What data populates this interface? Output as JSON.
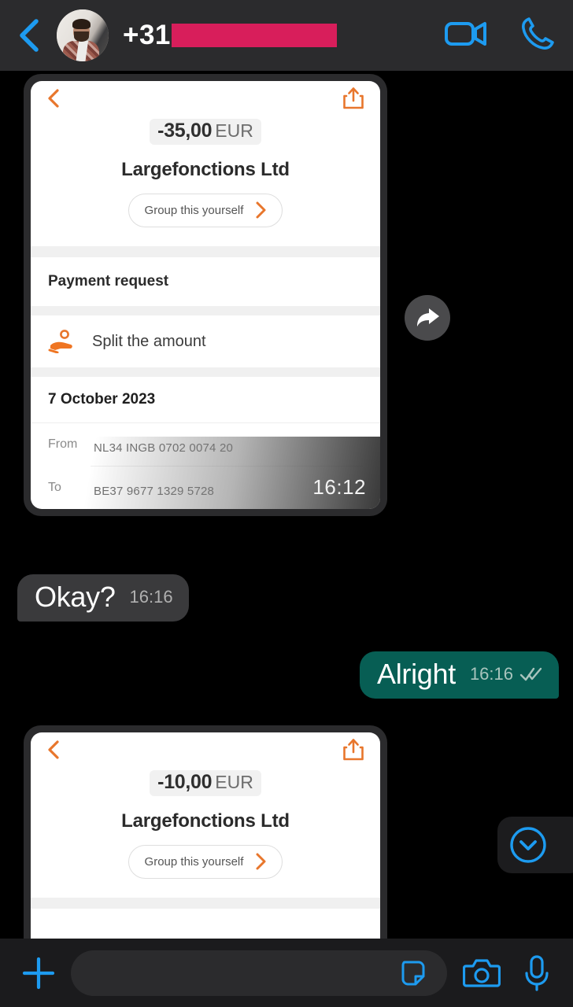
{
  "app": "whatsapp-chat",
  "header": {
    "back_icon": "chevron-left-icon",
    "avatar_icon": "contact-avatar",
    "phone_prefix": "+31",
    "phone_redacted": true,
    "redaction_color": "#d81e5b",
    "video_call_icon": "video-camera-icon",
    "voice_call_icon": "phone-icon",
    "accent_color": "#1d9bf0",
    "background": "#2b2b2d"
  },
  "messages": [
    {
      "type": "payment-card",
      "card": {
        "back_icon": "chevron-left-icon",
        "share_icon": "share-upload-icon",
        "amount": "-35,00",
        "currency": "EUR",
        "merchant": "Largefonctions Ltd",
        "pill_label": "Group this yourself",
        "pill_chevron_icon": "chevron-right-icon",
        "section_title": "Payment request",
        "split_icon": "hand-coin-icon",
        "split_label": "Split the amount",
        "date": "7 October 2023",
        "from_label": "From",
        "from_name_redacted": true,
        "from_iban": "NL34 INGB 0702 0074 20",
        "to_label": "To",
        "to_name_redacted": true,
        "to_iban": "BE37 9677 1329 5728"
      },
      "time": "16:12",
      "accent_color": "#e8762c"
    },
    {
      "type": "text",
      "direction": "incoming",
      "text": "Okay?",
      "time": "16:16",
      "bubble_color": "#3a3a3c"
    },
    {
      "type": "text",
      "direction": "outgoing",
      "text": "Alright",
      "time": "16:16",
      "status_icon": "double-check-icon",
      "bubble_color": "#075e54"
    },
    {
      "type": "payment-card",
      "card": {
        "back_icon": "chevron-left-icon",
        "share_icon": "share-upload-icon",
        "amount": "-10,00",
        "currency": "EUR",
        "merchant": "Largefonctions Ltd",
        "pill_label": "Group this yourself",
        "pill_chevron_icon": "chevron-right-icon"
      },
      "accent_color": "#e8762c"
    }
  ],
  "overlays": {
    "forward_button_icon": "forward-arrow-icon",
    "scroll_to_bottom_icon": "chevron-down-circle-icon"
  },
  "footer": {
    "attach_icon": "plus-icon",
    "input_value": "",
    "input_placeholder": "",
    "sticker_icon": "sticker-icon",
    "camera_icon": "camera-icon",
    "mic_icon": "microphone-icon",
    "background": "#1b1b1d"
  }
}
